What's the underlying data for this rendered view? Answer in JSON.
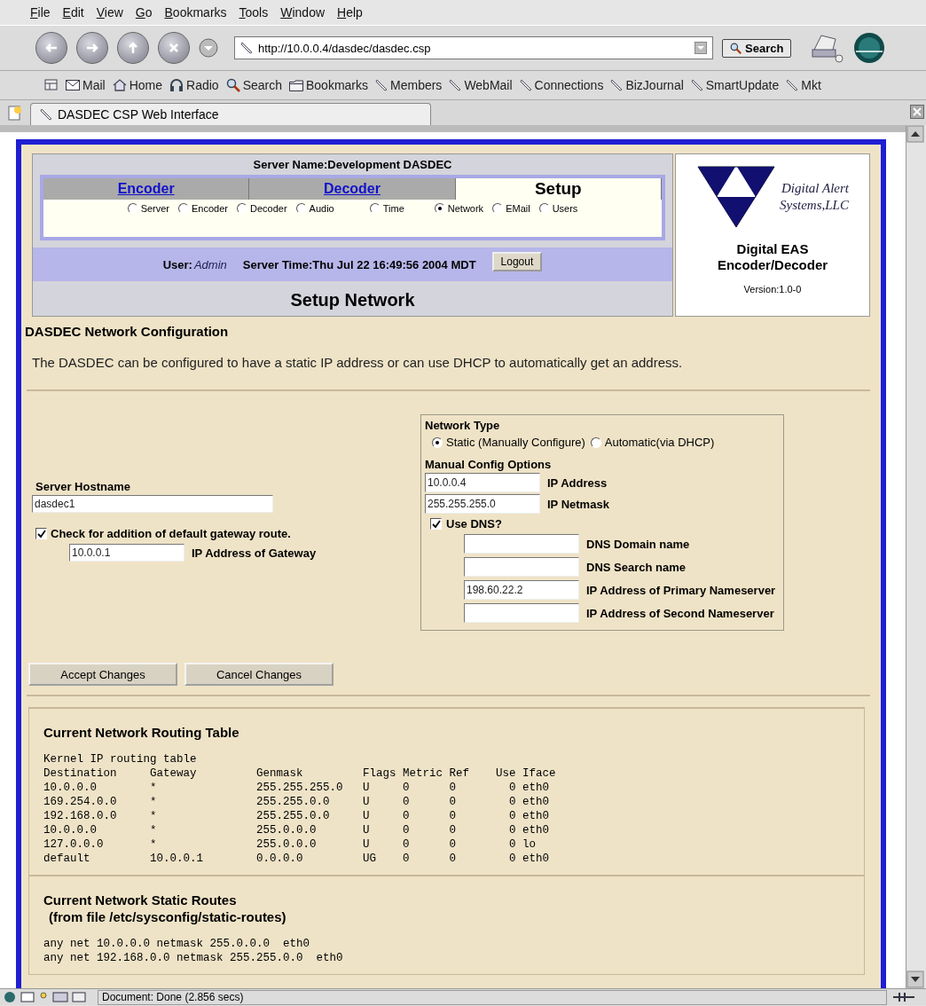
{
  "menu_bar": [
    "File",
    "Edit",
    "View",
    "Go",
    "Bookmarks",
    "Tools",
    "Window",
    "Help"
  ],
  "nav_toolbar": {
    "url": "http://10.0.0.4/dasdec/dasdec.csp",
    "search_button": "Search"
  },
  "personal_toolbar": [
    {
      "label": "Mail",
      "kind": "mail"
    },
    {
      "label": "Home",
      "kind": "home"
    },
    {
      "label": "Radio",
      "kind": "radio"
    },
    {
      "label": "Search",
      "kind": "search"
    },
    {
      "label": "Bookmarks",
      "kind": "folder"
    },
    {
      "label": "Members",
      "kind": "bookmark"
    },
    {
      "label": "WebMail",
      "kind": "bookmark"
    },
    {
      "label": "Connections",
      "kind": "bookmark"
    },
    {
      "label": "BizJournal",
      "kind": "bookmark"
    },
    {
      "label": "SmartUpdate",
      "kind": "bookmark"
    },
    {
      "label": "Mkt",
      "kind": "bookmark"
    }
  ],
  "browser_tab": {
    "title": "DASDEC CSP Web Interface"
  },
  "header": {
    "server_name": "Server Name:Development DASDEC",
    "nav_tabs": [
      {
        "label": "Encoder",
        "selected": false
      },
      {
        "label": "Decoder",
        "selected": false
      },
      {
        "label": "Setup",
        "selected": true
      }
    ],
    "setup_options": [
      {
        "label": "Server",
        "selected": false
      },
      {
        "label": "Encoder",
        "selected": false
      },
      {
        "label": "Decoder",
        "selected": false
      },
      {
        "label": "Audio",
        "selected": false
      },
      {
        "label": "Time",
        "selected": false
      },
      {
        "label": "Network",
        "selected": true
      },
      {
        "label": "EMail",
        "selected": false
      },
      {
        "label": "Users",
        "selected": false
      }
    ],
    "user_label": "User:",
    "user": "Admin",
    "server_time": "Server Time:Thu Jul 22 16:49:56 2004 MDT",
    "logout_button": "Logout",
    "page_title": "Setup Network",
    "brand": {
      "name_line1": "Digital Alert",
      "name_line2": "Systems,LLC",
      "product_line1": "Digital EAS",
      "product_line2": "Encoder/Decoder",
      "version": "Version:1.0-0"
    }
  },
  "section_title": "DASDEC Network Configuration",
  "description": "The DASDEC can be configured to have a static IP address or can use DHCP to automatically get an address.",
  "hostname": {
    "label": "Server Hostname",
    "value": "dasdec1"
  },
  "gateway": {
    "label": "Check for addition of default gateway route.",
    "checked": true,
    "value": "10.0.0.1",
    "field_label": "IP Address of Gateway"
  },
  "network_type": {
    "title": "Network Type",
    "options": [
      {
        "label": "Static (Manually Configure)",
        "selected": true
      },
      {
        "label": "Automatic(via DHCP)",
        "selected": false
      }
    ]
  },
  "manual_config": {
    "title": "Manual Config Options",
    "fields": [
      {
        "value": "10.0.0.4",
        "label": "IP Address"
      },
      {
        "value": "255.255.255.0",
        "label": "IP Netmask"
      }
    ]
  },
  "use_dns": {
    "label": "Use DNS?",
    "checked": true
  },
  "dns_fields": [
    {
      "label": "DNS Domain name"
    },
    {
      "label": "DNS Search name"
    },
    {
      "value": "198.60.22.2",
      "label": "IP Address of Primary Nameserver"
    },
    {
      "label": "IP Address of Second Nameserver"
    }
  ],
  "buttons": [
    "Accept Changes",
    "Cancel Changes"
  ],
  "routing_table": {
    "title": "Current Network Routing Table",
    "heading": "Kernel IP routing table",
    "columns": [
      "Destination",
      "Gateway",
      "Genmask",
      "Flags",
      "Metric",
      "Ref",
      "Use",
      "Iface"
    ],
    "rows": [
      [
        "10.0.0.0",
        "*",
        "255.255.255.0",
        "U",
        "0",
        "0",
        "0",
        "eth0"
      ],
      [
        "169.254.0.0",
        "*",
        "255.255.0.0",
        "U",
        "0",
        "0",
        "0",
        "eth0"
      ],
      [
        "192.168.0.0",
        "*",
        "255.255.0.0",
        "U",
        "0",
        "0",
        "0",
        "eth0"
      ],
      [
        "10.0.0.0",
        "*",
        "255.0.0.0",
        "U",
        "0",
        "0",
        "0",
        "eth0"
      ],
      [
        "127.0.0.0",
        "*",
        "255.0.0.0",
        "U",
        "0",
        "0",
        "0",
        "lo"
      ],
      [
        "default",
        "10.0.0.1",
        "0.0.0.0",
        "UG",
        "0",
        "0",
        "0",
        "eth0"
      ]
    ]
  },
  "static_routes": {
    "title": "Current Network Static Routes",
    "subtitle": "(from file /etc/sysconfig/static-routes)",
    "lines": [
      "any net 10.0.0.0 netmask 255.0.0.0  eth0",
      "any net 192.168.0.0 netmask 255.255.0.0  eth0"
    ]
  },
  "status_bar": {
    "text": "Document: Done (2.856 secs)"
  }
}
